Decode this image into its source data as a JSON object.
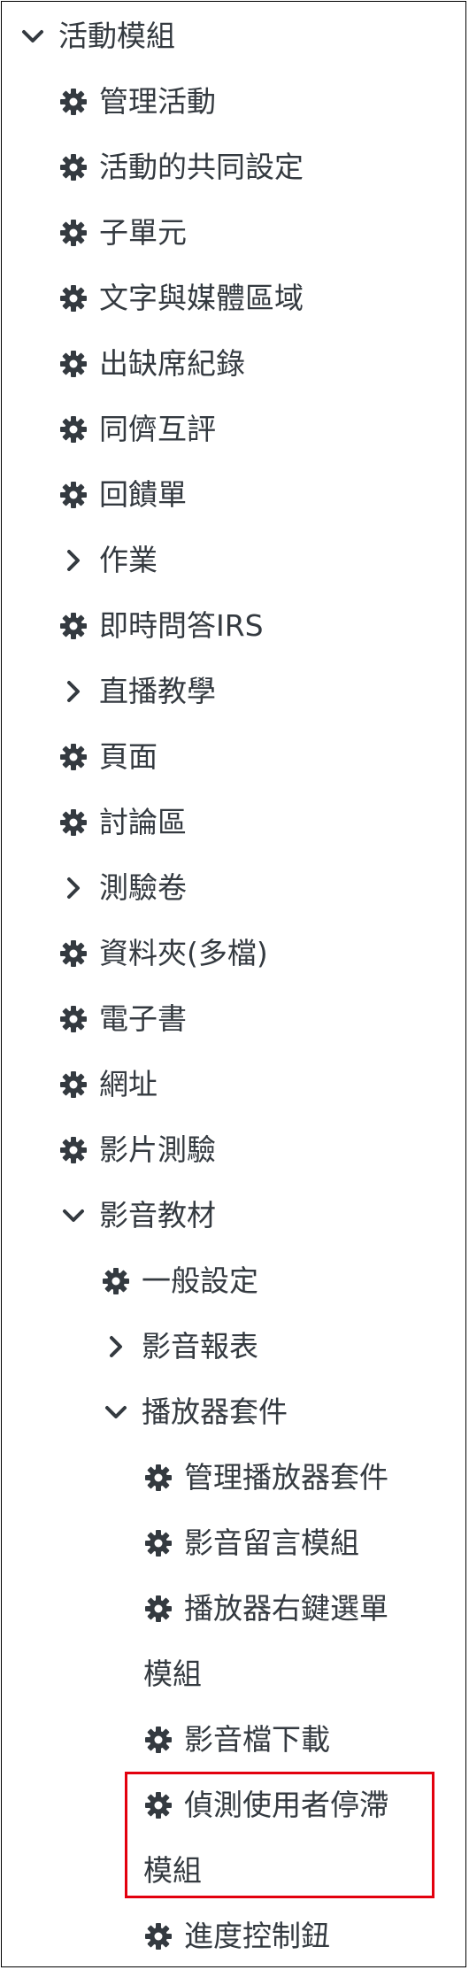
{
  "menu": {
    "root": "活動模組",
    "level1": [
      "管理活動",
      "活動的共同設定",
      "子單元",
      "文字與媒體區域",
      "出缺席紀錄",
      "同儕互評",
      "回饋單",
      "作業",
      "即時問答IRS",
      "直播教學",
      "頁面",
      "討論區",
      "測驗卷",
      "資料夾(多檔)",
      "電子書",
      "網址",
      "影片測驗",
      "影音教材"
    ],
    "level2": [
      "一般設定",
      "影音報表",
      "播放器套件"
    ],
    "level3": [
      "管理播放器套件",
      "影音留言模組",
      "播放器右鍵選單",
      "模組",
      "影音檔下載",
      "偵測使用者停滯",
      "模組",
      "進度控制鈕"
    ]
  },
  "icons": {
    "gear": "gear-icon",
    "expand": "chevron-down-icon",
    "collapse": "chevron-right-icon"
  },
  "colors": {
    "icon": "#343a40",
    "text": "#343a40",
    "highlight": "#e3000e"
  }
}
